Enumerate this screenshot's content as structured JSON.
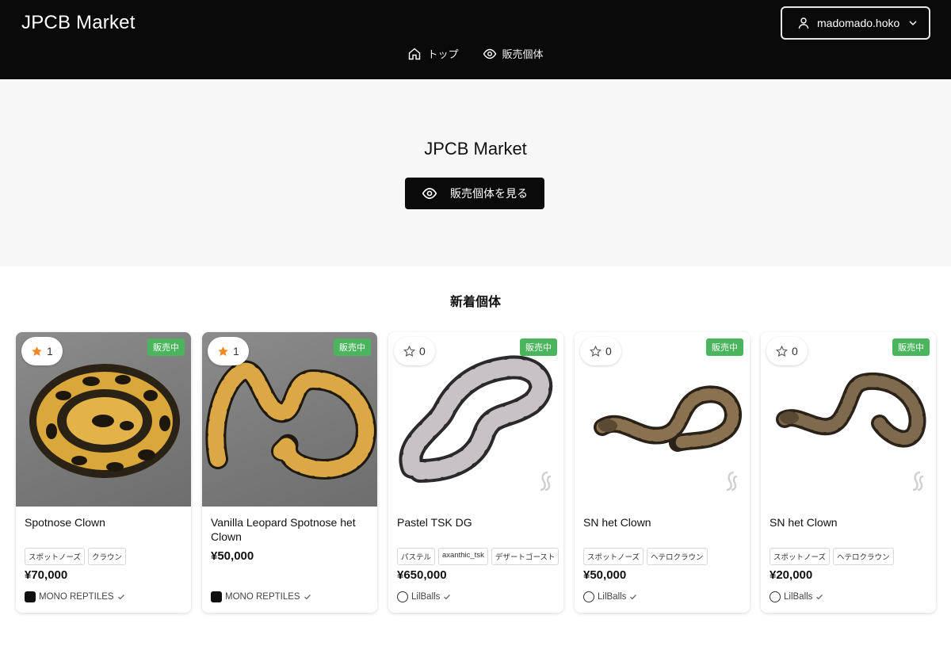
{
  "header": {
    "brand": "JPCB Market",
    "user": "madomado.hoko",
    "nav": [
      {
        "label": "トップ",
        "icon": "home-icon"
      },
      {
        "label": "販売個体",
        "icon": "eye-icon"
      }
    ]
  },
  "hero": {
    "title": "JPCB Market",
    "button_label": "販売個体を見る"
  },
  "section": {
    "title": "新着個体"
  },
  "cards": [
    {
      "fav_count": "1",
      "fav_active": true,
      "status": "販売中",
      "title": "Spotnose Clown",
      "tags": [
        "スポットノーズ",
        "クラウン"
      ],
      "price": "¥70,000",
      "seller": "MONO REPTILES"
    },
    {
      "fav_count": "1",
      "fav_active": true,
      "status": "販売中",
      "title": "Vanilla Leopard Spotnose het Clown",
      "tags": [],
      "price": "¥50,000",
      "seller": "MONO REPTILES"
    },
    {
      "fav_count": "0",
      "fav_active": false,
      "status": "販売中",
      "title": "Pastel TSK DG",
      "tags": [
        "パステル",
        "axanthic_tsk",
        "デザートゴースト"
      ],
      "price": "¥650,000",
      "seller": "LilBalls"
    },
    {
      "fav_count": "0",
      "fav_active": false,
      "status": "販売中",
      "title": "SN het Clown",
      "tags": [
        "スポットノーズ",
        "ヘテロクラウン"
      ],
      "price": "¥50,000",
      "seller": "LilBalls"
    },
    {
      "fav_count": "0",
      "fav_active": false,
      "status": "販売中",
      "title": "SN het Clown",
      "tags": [
        "スポットノーズ",
        "ヘテロクラウン"
      ],
      "price": "¥20,000",
      "seller": "LilBalls"
    }
  ],
  "colors": {
    "header_bg": "#0a0a0a",
    "hero_bg": "#f7f7f7",
    "badge_green": "#4bb55d",
    "star_orange": "#f08a24"
  }
}
